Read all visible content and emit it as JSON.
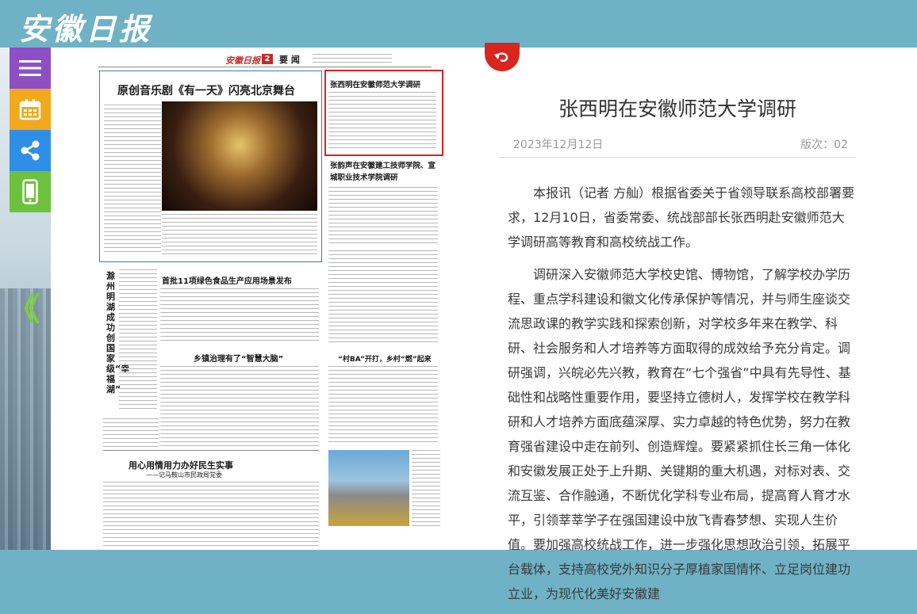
{
  "header": {
    "logo": "安徽日报"
  },
  "sidebar": {
    "collapse_glyph": "《"
  },
  "newspaper": {
    "masthead_logo": "安徽日报",
    "page_no": "2",
    "section": "要 闻",
    "headlines": {
      "music": "原创音乐剧《有一天》闪亮北京舞台",
      "zxm": "张西明在安徽师范大学调研",
      "zyx": "张韵声在安徽建工技师学院、宣城职业技术学院调研",
      "green": "首批11项绿色食品生产应用场景发布",
      "township": "乡镇治理有了“智慧大脑”",
      "vertical": "滁州明湖成功创国家级“幸福湖”",
      "livelihood": "用心用情用力办好民生实事",
      "livelihood_sub": "——记马鞍山市民政局党委",
      "village_ba": "“村BA”开打，乡村“燃”起来"
    }
  },
  "article": {
    "title": "张西明在安徽师范大学调研",
    "date": "2023年12月12日",
    "edition": "版次：02",
    "paragraphs": [
      "本报讯（记者 方舢）根据省委关于省领导联系高校部署要求，12月10日，省委常委、统战部部长张西明赴安徽师范大学调研高等教育和高校统战工作。",
      "调研深入安徽师范大学校史馆、博物馆，了解学校办学历程、重点学科建设和徽文化传承保护等情况，并与师生座谈交流思政课的教学实践和探索创新，对学校多年来在教学、科研、社会服务和人才培养等方面取得的成效给予充分肯定。调研强调，兴皖必先兴教，教育在“七个强省”中具有先导性、基础性和战略性重要作用，要坚持立德树人，发挥学校在教学科研和人才培养方面底蕴深厚、实力卓越的特色优势，努力在教育强省建设中走在前列、创造辉煌。要紧紧抓住长三角一体化和安徽发展正处于上升期、关键期的重大机遇，对标对表、交流互鉴、合作融通，不断优化学科专业布局，提高育人育才水平，引领莘莘学子在强国建设中放飞青春梦想、实现人生价值。要加强高校统战工作，进一步强化思想政治引领，拓展平台载体，支持高校党外知识分子厚植家国情怀、立足岗位建功立业，为现代化美好安徽建"
    ]
  },
  "colors": {
    "header_bg": "#6fb2c5",
    "highlight": "#e02020",
    "back_button": "#d8261f"
  }
}
